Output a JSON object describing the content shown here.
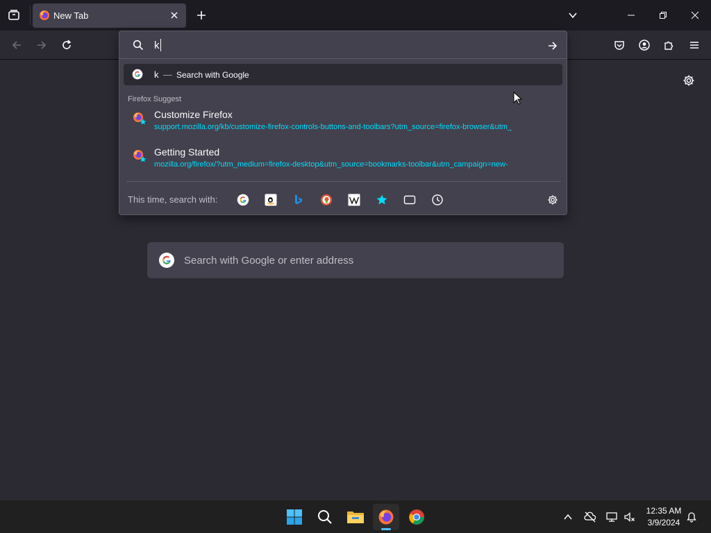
{
  "colors": {
    "accent": "#00ddff",
    "panel": "#42414d",
    "toolbar": "#2b2a33",
    "background": "#1c1b22"
  },
  "tab": {
    "title": "New Tab"
  },
  "urlbar": {
    "value": "k",
    "google_row": {
      "query": "k",
      "separator": "—",
      "label": "Search with Google"
    },
    "suggest_heading": "Firefox Suggest",
    "suggestions": [
      {
        "title": "Customize Firefox",
        "url": "support.mozilla.org/kb/customize-firefox-controls-buttons-and-toolbars?utm_source=firefox-browser&utm_"
      },
      {
        "title": "Getting Started",
        "url": "mozilla.org/firefox/?utm_medium=firefox-desktop&utm_source=bookmarks-toolbar&utm_campaign=new-"
      }
    ],
    "search_with_label": "This time, search with:",
    "engines": [
      "google-icon",
      "amazon-icon",
      "bing-icon",
      "duckduckgo-icon",
      "wikipedia-icon",
      "bookmarks-icon",
      "tabs-icon",
      "history-icon"
    ]
  },
  "content": {
    "search_placeholder": "Search with Google or enter address"
  },
  "taskbar": {
    "time": "12:35 AM",
    "date": "3/9/2024"
  }
}
